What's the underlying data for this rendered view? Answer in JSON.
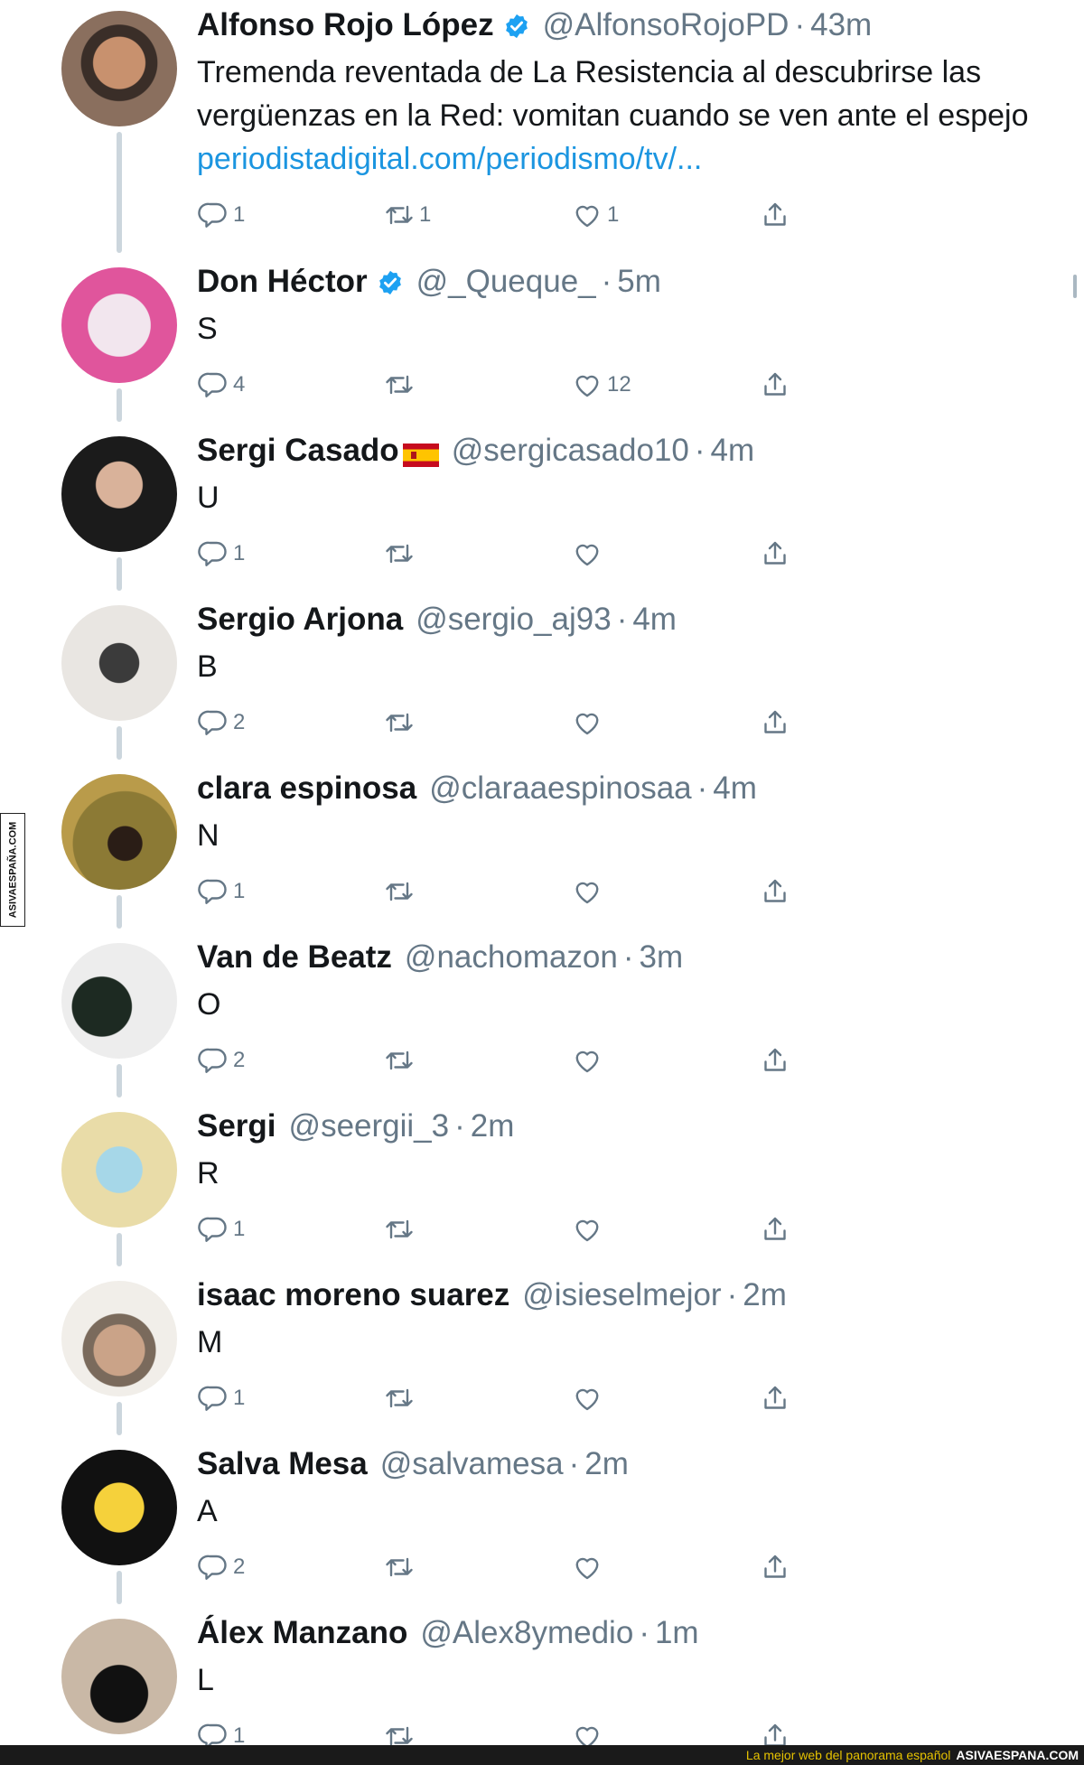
{
  "colors": {
    "handle": "#657786",
    "link": "#1b95e0",
    "verified": "#1da1f2",
    "thread": "#ccd6dd"
  },
  "tweets": [
    {
      "name": "Alfonso Rojo López",
      "verified": true,
      "handle": "@AlfonsoRojoPD",
      "time": "43m",
      "lines": [
        "Tremenda reventada de La Resistencia al descubrirse las",
        "vergüenzas en la Red: vomitan cuando se ven ante el espejo"
      ],
      "link": "periodistadigital.com/periodismo/tv/...",
      "replies": "1",
      "retweets": "1",
      "likes": "1",
      "avatar_icon": "man-photo"
    },
    {
      "name": "Don Héctor",
      "verified": true,
      "handle": "@_Queque_",
      "time": "5m",
      "lines": [
        "S"
      ],
      "replies": "4",
      "retweets": "",
      "likes": "12",
      "avatar_icon": "pink-illustration"
    },
    {
      "name": "Sergi Casado",
      "flag_icon": "spain-flag-icon",
      "handle": "@sergicasado10",
      "time": "4m",
      "lines": [
        "U"
      ],
      "replies": "1",
      "retweets": "",
      "likes": "",
      "avatar_icon": "man-photo"
    },
    {
      "name": "Sergio Arjona",
      "handle": "@sergio_aj93",
      "time": "4m",
      "lines": [
        "B"
      ],
      "replies": "2",
      "retweets": "",
      "likes": "",
      "avatar_icon": "sunglasses-mug-photo"
    },
    {
      "name": "clara espinosa",
      "handle": "@claraaespinosaa",
      "time": "4m",
      "lines": [
        "N"
      ],
      "replies": "1",
      "retweets": "",
      "likes": "",
      "avatar_icon": "forest-photo"
    },
    {
      "name": "Van de Beatz",
      "handle": "@nachomazon",
      "time": "3m",
      "lines": [
        "O"
      ],
      "replies": "2",
      "retweets": "",
      "likes": "",
      "avatar_icon": "masked-figure"
    },
    {
      "name": "Sergi",
      "handle": "@seergii_3",
      "time": "2m",
      "lines": [
        "R"
      ],
      "replies": "1",
      "retweets": "",
      "likes": "",
      "avatar_icon": "rick-cartoon"
    },
    {
      "name": "isaac moreno suarez",
      "handle": "@isieselmejor",
      "time": "2m",
      "lines": [
        "M"
      ],
      "replies": "1",
      "retweets": "",
      "likes": "",
      "avatar_icon": "hat-man-photo"
    },
    {
      "name": "Salva Mesa",
      "handle": "@salvamesa",
      "time": "2m",
      "lines": [
        "A"
      ],
      "replies": "2",
      "retweets": "",
      "likes": "",
      "avatar_icon": "homer-cartoon"
    },
    {
      "name": "Álex Manzano",
      "handle": "@Alex8ymedio",
      "time": "1m",
      "lines": [
        "L"
      ],
      "replies": "1",
      "retweets": "",
      "likes": "",
      "avatar_icon": "dog-photo"
    }
  ],
  "watermark": "ASIVAESPAÑA.COM",
  "footer": {
    "tagline": "La mejor web del panorama español",
    "site": "ASIVAESPANA.COM"
  }
}
